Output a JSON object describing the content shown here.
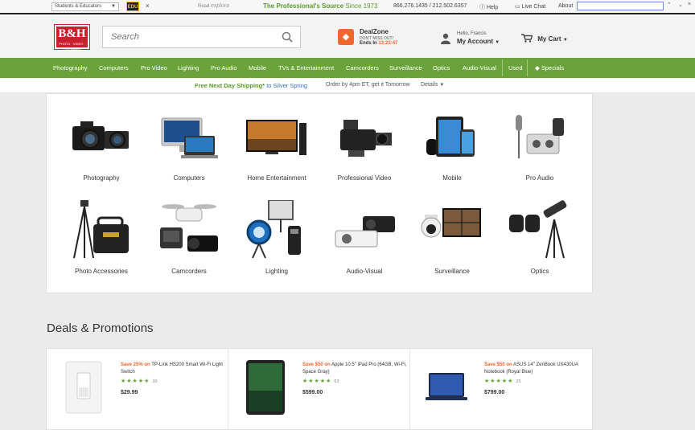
{
  "topbar": {
    "selector": "Students & Educators",
    "edu_badge": "EDU",
    "close": "×",
    "read_label": "Read",
    "read_brand": "explora",
    "slogan": "The Professional's Source",
    "slogan_since": "Since 1973",
    "phone": "866.276.1435 / 212.502.6357",
    "help": "Help",
    "live_chat": "Live Chat",
    "about": "About"
  },
  "header": {
    "logo_main": "B&H",
    "logo_sub": "PHOTO · VIDEO · PRO AUDIO",
    "search_placeholder": "Search",
    "dealzone_title": "DealZone",
    "dealzone_sub": "DON'T MISS OUT!",
    "dealzone_ends": "Ends In",
    "dealzone_timer": "13:23:47",
    "hello": "Hello, Francis",
    "my_account": "My Account",
    "my_cart": "My Cart"
  },
  "nav": {
    "items": [
      "Photography",
      "Computers",
      "Pro Video",
      "Lighting",
      "Pro Audio",
      "Mobile",
      "TVs & Entertainment",
      "Camcorders",
      "Surveillance",
      "Optics",
      "Audio-Visual",
      "Used",
      "Specials"
    ]
  },
  "shipping": {
    "free": "Free Next Day Shipping*",
    "to": "to Silver Spring",
    "order": "Order by 4pm ET, get it Tomorrow",
    "details": "Details"
  },
  "categories": [
    {
      "label": "Photography",
      "icon": "camera-icon"
    },
    {
      "label": "Computers",
      "icon": "computer-icon"
    },
    {
      "label": "Home Entertainment",
      "icon": "tv-icon"
    },
    {
      "label": "Professional Video",
      "icon": "video-camera-icon"
    },
    {
      "label": "Mobile",
      "icon": "tablet-icon"
    },
    {
      "label": "Pro Audio",
      "icon": "microphone-icon"
    },
    {
      "label": "Photo Accessories",
      "icon": "tripod-icon"
    },
    {
      "label": "Camcorders",
      "icon": "drone-icon"
    },
    {
      "label": "Lighting",
      "icon": "light-icon"
    },
    {
      "label": "Audio-Visual",
      "icon": "projector-icon"
    },
    {
      "label": "Surveillance",
      "icon": "security-camera-icon"
    },
    {
      "label": "Optics",
      "icon": "binoculars-icon"
    }
  ],
  "deals": {
    "title": "Deals & Promotions",
    "items": [
      {
        "save": "Save 25% on",
        "name": "TP-Link HS200 Smart Wi-Fi Light Switch",
        "stars": "★★★★★",
        "reviews": "30",
        "price": "$29.99"
      },
      {
        "save": "Save $50 on",
        "name": "Apple 10.5\" iPad Pro (64GB, Wi-Fi, Space Gray)",
        "stars": "★★★★★",
        "reviews": "53",
        "price": "$599.00"
      },
      {
        "save": "Save $50 on",
        "name": "ASUS 14\" ZenBook UX430UA Notebook (Royal Blue)",
        "stars": "★★★★★",
        "reviews": "25",
        "price": "$799.00"
      }
    ]
  },
  "colors": {
    "brand_red": "#c8202c",
    "nav_green": "#6aa33a",
    "deal_orange": "#f0672d",
    "link_blue": "#3b73b9"
  }
}
